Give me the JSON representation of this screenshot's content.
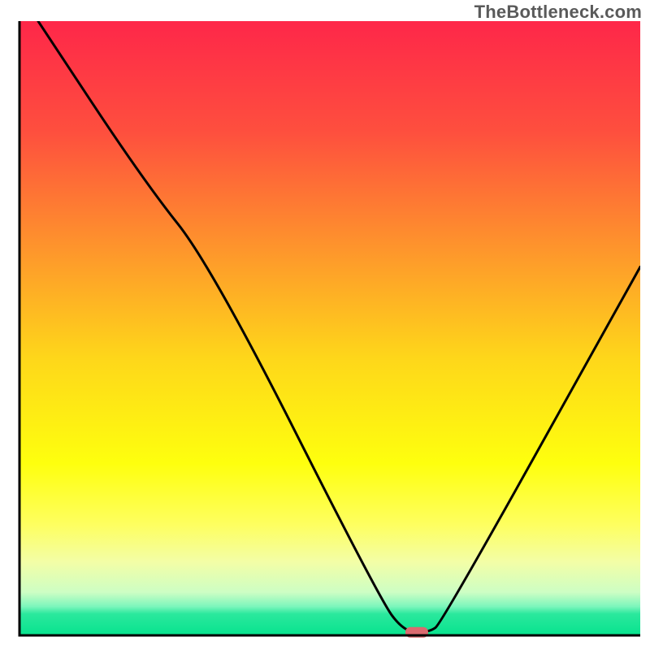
{
  "watermark": "TheBottleneck.com",
  "chart_data": {
    "type": "line",
    "title": "",
    "xlabel": "",
    "ylabel": "",
    "xlim": [
      0,
      100
    ],
    "ylim": [
      0,
      100
    ],
    "grid": false,
    "legend": false,
    "series": [
      {
        "name": "bottleneck-curve",
        "x": [
          3,
          20,
          31,
          58,
          62,
          66,
          68,
          100
        ],
        "values": [
          100,
          74,
          60,
          6,
          0.5,
          0.5,
          2,
          60
        ]
      }
    ],
    "markers": [
      {
        "name": "indicator",
        "x": 64,
        "y": 0.5,
        "color": "#db6a6f"
      }
    ],
    "background_gradient_stops": [
      {
        "pos": 0.0,
        "color": "#fe2749"
      },
      {
        "pos": 0.18,
        "color": "#fe4f3e"
      },
      {
        "pos": 0.4,
        "color": "#fea029"
      },
      {
        "pos": 0.55,
        "color": "#fed71a"
      },
      {
        "pos": 0.72,
        "color": "#feff0e"
      },
      {
        "pos": 0.82,
        "color": "#feff60"
      },
      {
        "pos": 0.88,
        "color": "#f3fea6"
      },
      {
        "pos": 0.93,
        "color": "#cdfec4"
      },
      {
        "pos": 0.953,
        "color": "#7cf6bc"
      },
      {
        "pos": 0.965,
        "color": "#2be89d"
      },
      {
        "pos": 1.0,
        "color": "#07e38e"
      }
    ],
    "axis_color": "#000000",
    "curve_color": "#000000"
  }
}
